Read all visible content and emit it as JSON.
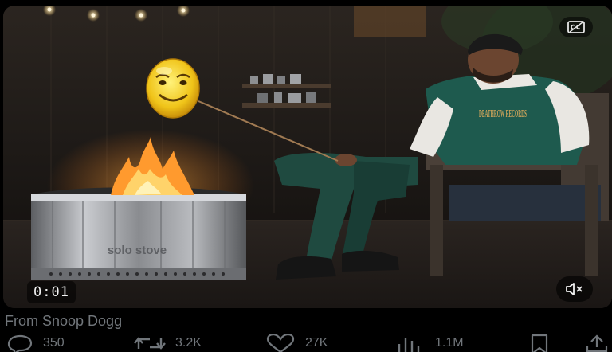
{
  "video": {
    "timestamp": "0:01",
    "brand_text": "solo stove",
    "jacket_text": "DEATHROW RECORDS",
    "captions_icon": "closed-captions-icon",
    "mute_icon": "speaker-muted-icon"
  },
  "post": {
    "source_label": "From Snoop Dogg"
  },
  "actions": {
    "replies": "350",
    "reposts": "3.2K",
    "likes": "27K",
    "views": "1.1M"
  },
  "colors": {
    "background": "#000000",
    "muted_text": "#71767b"
  }
}
